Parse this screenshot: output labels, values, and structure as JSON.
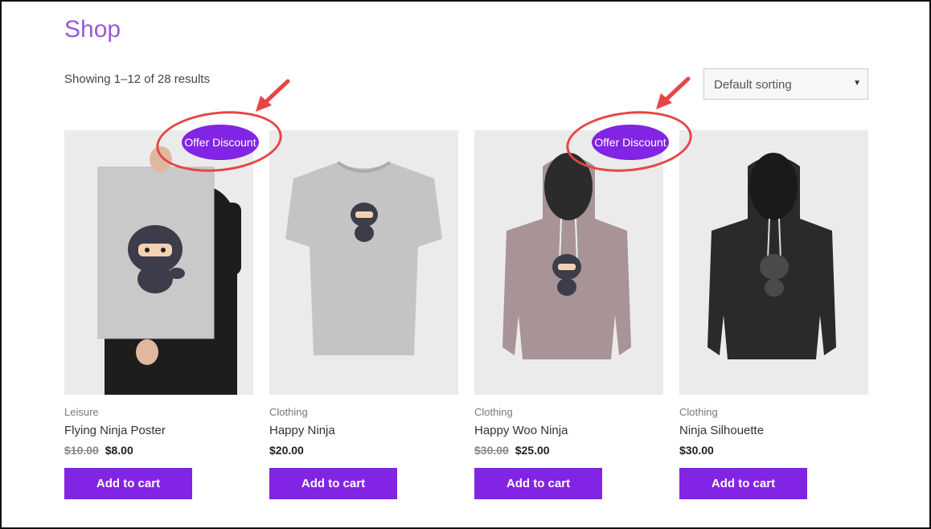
{
  "shop": {
    "title": "Shop",
    "result_count": "Showing 1–12 of 28 results",
    "sorting": {
      "selected": "Default sorting"
    }
  },
  "badge_label": "Offer Discount",
  "add_to_cart_label": "Add to cart",
  "colors": {
    "accent": "#8224e3",
    "title": "#9b59d8",
    "annotation": "#e64545"
  },
  "products": [
    {
      "category": "Leisure",
      "name": "Flying Ninja Poster",
      "old_price": "$10.00",
      "price": "$8.00",
      "image": "ninja-poster-image"
    },
    {
      "category": "Clothing",
      "name": "Happy Ninja",
      "old_price": "",
      "price": "$20.00",
      "image": "ninja-tshirt-image"
    },
    {
      "category": "Clothing",
      "name": "Happy Woo Ninja",
      "old_price": "$30.00",
      "price": "$25.00",
      "image": "ninja-pink-hoodie-image"
    },
    {
      "category": "Clothing",
      "name": "Ninja Silhouette",
      "old_price": "",
      "price": "$30.00",
      "image": "ninja-black-hoodie-image"
    }
  ]
}
